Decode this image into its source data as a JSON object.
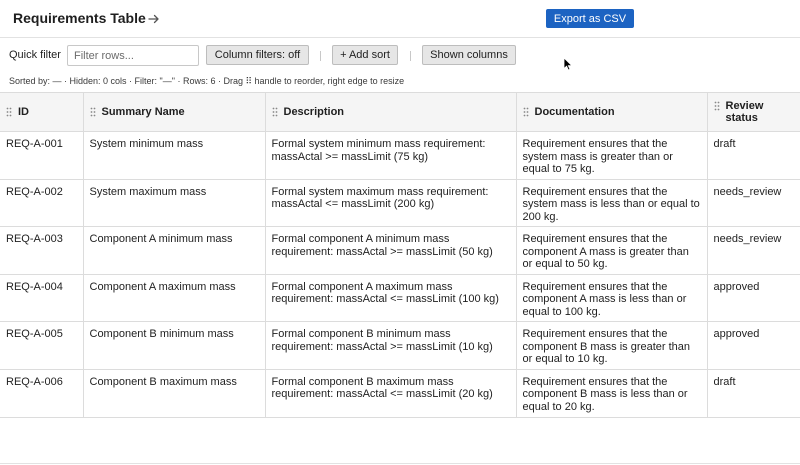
{
  "header": {
    "title": "Requirements Table",
    "export_label": "Export as CSV"
  },
  "toolbar": {
    "quick_filter_label": "Quick filter",
    "filter_placeholder": "Filter rows...",
    "column_filters_label": "Column filters: off",
    "add_sort_label": "+ Add sort",
    "shown_columns_label": "Shown columns"
  },
  "status": "Sorted by: — · Hidden: 0 cols · Filter: \"—\" · Rows: 6 · Drag ⠿ handle to reorder, right edge to resize",
  "columns": [
    "ID",
    "Summary Name",
    "Description",
    "Documentation",
    "Review status"
  ],
  "rows": [
    {
      "id": "REQ-A-001",
      "summary": "System minimum mass",
      "description": "Formal system minimum mass requirement: massActal >= massLimit (75 kg)",
      "documentation": "Requirement ensures that the system mass is greater than or equal to 75 kg.",
      "status": "draft"
    },
    {
      "id": "REQ-A-002",
      "summary": "System maximum mass",
      "description": "Formal system maximum mass requirement: massActal <= massLimit (200 kg)",
      "documentation": "Requirement ensures that the system mass is less than or equal to 200 kg.",
      "status": "needs_review"
    },
    {
      "id": "REQ-A-003",
      "summary": "Component A minimum mass",
      "description": "Formal component A minimum mass requirement: massActal >= massLimit (50 kg)",
      "documentation": "Requirement ensures that the component A mass is greater than or equal to 50 kg.",
      "status": "needs_review"
    },
    {
      "id": "REQ-A-004",
      "summary": "Component A maximum mass",
      "description": "Formal component A maximum mass requirement: massActal <= massLimit (100 kg)",
      "documentation": "Requirement ensures that the component A mass is less than or equal to 100 kg.",
      "status": "approved"
    },
    {
      "id": "REQ-A-005",
      "summary": "Component B minimum mass",
      "description": "Formal component B minimum mass requirement: massActal >= massLimit (10 kg)",
      "documentation": "Requirement ensures that the component B mass is greater than or equal to 10 kg.",
      "status": "approved"
    },
    {
      "id": "REQ-A-006",
      "summary": "Component B maximum mass",
      "description": "Formal component B maximum mass requirement: massActal <= massLimit (20 kg)",
      "documentation": "Requirement ensures that the component B mass is less than or equal to 20 kg.",
      "status": "draft"
    }
  ],
  "colors": {
    "accent": "#1c63c2",
    "header_bg": "#f5f5f5",
    "border": "#dcdcdc"
  }
}
